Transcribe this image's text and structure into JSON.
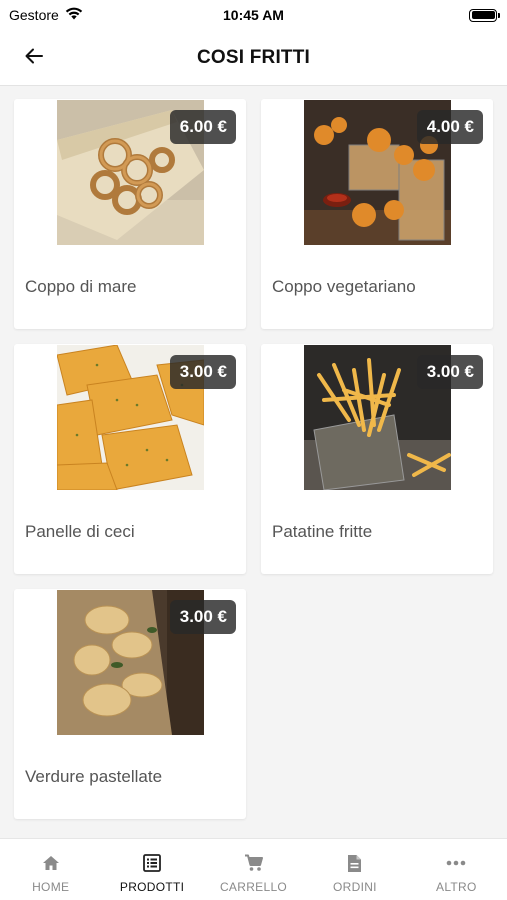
{
  "status": {
    "carrier": "Gestore",
    "time": "10:45 AM"
  },
  "header": {
    "title": "COSI FRITTI"
  },
  "products": [
    {
      "name": "Coppo di mare",
      "price": "6.00 €"
    },
    {
      "name": "Coppo vegetariano",
      "price": "4.00 €"
    },
    {
      "name": "Panelle di ceci",
      "price": "3.00 €"
    },
    {
      "name": "Patatine fritte",
      "price": "3.00 €"
    },
    {
      "name": "Verdure pastellate",
      "price": "3.00 €"
    }
  ],
  "nav": {
    "items": [
      {
        "label": "HOME",
        "icon": "home-icon"
      },
      {
        "label": "PRODOTTI",
        "icon": "list-icon",
        "active": true
      },
      {
        "label": "CARRELLO",
        "icon": "cart-icon"
      },
      {
        "label": "ORDINI",
        "icon": "document-icon"
      },
      {
        "label": "ALTRO",
        "icon": "more-icon"
      }
    ]
  },
  "colors": {
    "background": "#f4f4f4",
    "badge": "#282828",
    "nav_inactive": "#8a8a8a",
    "nav_active": "#222222"
  }
}
